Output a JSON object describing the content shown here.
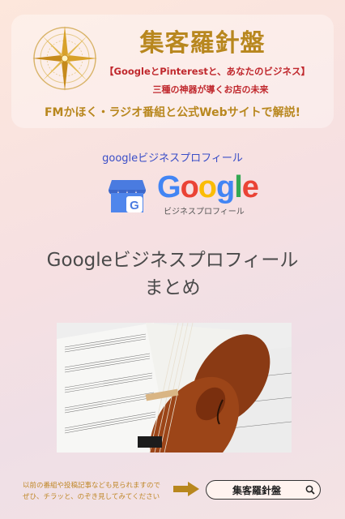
{
  "header": {
    "brand": "集客羅針盤",
    "subtitle": "【GoogleとPinterestと、あなたのビジネス】",
    "tagline": "三種の神器が導くお店の未来",
    "radio_line": "FMかほく・ラジオ番組と公式Webサイトで解説!"
  },
  "product": {
    "label": "googleビジネスプロフィール",
    "logo_word": "Google",
    "logo_sub": "ビジネスプロフィール"
  },
  "main": {
    "title_line1": "Googleビジネスプロフィール",
    "title_line2": "まとめ"
  },
  "footer": {
    "note_line1": "以前の番組や投稿記事なども見られますので",
    "note_line2": "ぜひ、チラッと、のぞき見してみてください",
    "search_text": "集客羅針盤"
  },
  "colors": {
    "brand_gold": "#b8871e",
    "accent_red": "#c0282d",
    "link_blue": "#3a4ec7"
  }
}
